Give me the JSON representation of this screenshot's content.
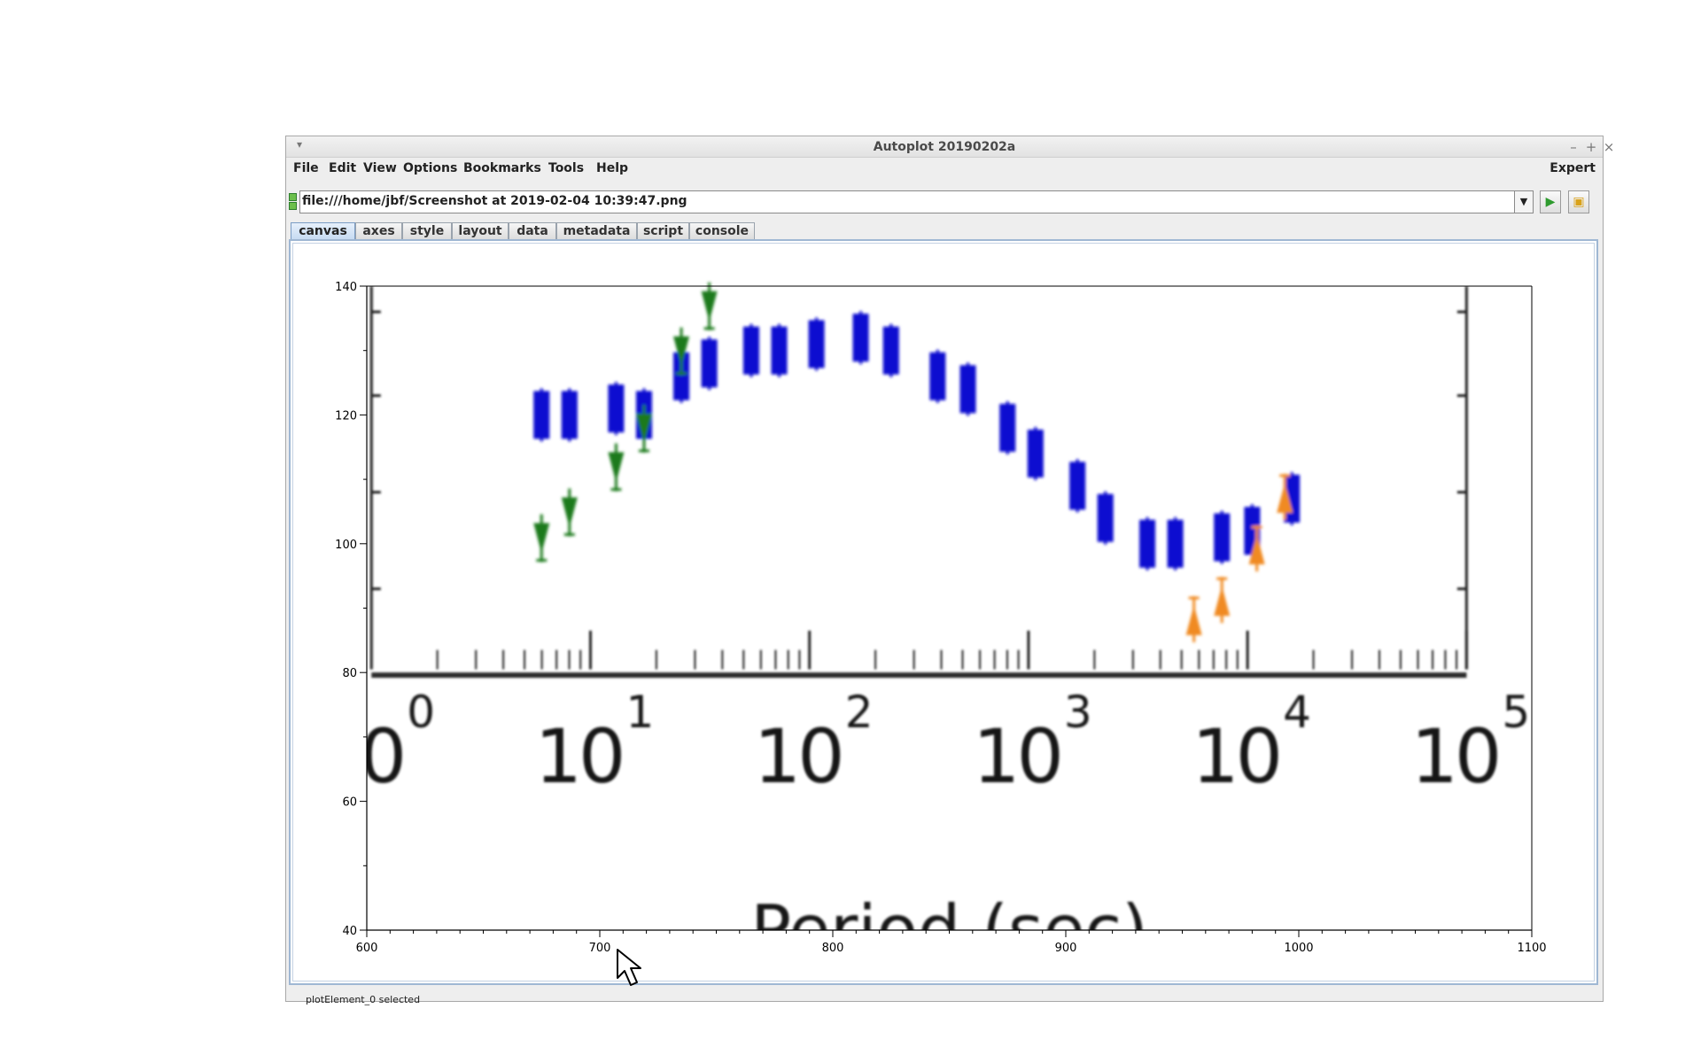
{
  "window": {
    "title": "Autoplot 20190202a"
  },
  "menubar": {
    "items": [
      "File",
      "Edit",
      "View",
      "Options",
      "Bookmarks",
      "Tools",
      "Help"
    ],
    "expert_label": "Expert"
  },
  "address": {
    "value": "file:///home/jbf/Screenshot at 2019-02-04 10:39:47.png"
  },
  "tabs": [
    "canvas",
    "axes",
    "style",
    "layout",
    "data",
    "metadata",
    "script",
    "console"
  ],
  "active_tab": "canvas",
  "status": {
    "text": "plotElement_0 selected"
  },
  "chart_data": {
    "type": "image",
    "x_ticks": [
      600,
      700,
      800,
      900,
      1000,
      1100
    ],
    "xlim": [
      600,
      1100
    ],
    "y_ticks": [
      40,
      60,
      80,
      100,
      120,
      140
    ],
    "ylim": [
      40,
      140
    ],
    "image_content": {
      "inner_x_tick_labels": [
        "0",
        "10",
        "10",
        "10",
        "10",
        "10"
      ],
      "inner_x_tick_exponents": [
        "0",
        "1",
        "2",
        "3",
        "4",
        "5"
      ],
      "inner_xlabel": "Period (sec)",
      "series": [
        {
          "color": "#0a0ad0",
          "marker": "square",
          "x": [
            675,
            687,
            707,
            719,
            735,
            747,
            765,
            777,
            793,
            812,
            825,
            845,
            858,
            875,
            887,
            905,
            917,
            935,
            947,
            967,
            980,
            997
          ],
          "y": [
            120,
            120,
            121,
            120,
            126,
            128,
            130,
            130,
            131,
            132,
            130,
            126,
            124,
            118,
            114,
            109,
            104,
            100,
            100,
            101,
            102,
            107
          ]
        },
        {
          "color": "#1a7a1a",
          "marker": "triangle-down",
          "x": [
            675,
            687,
            707,
            719,
            735,
            747
          ],
          "y": [
            101,
            105,
            112,
            118,
            130,
            137
          ]
        },
        {
          "color": "#f08a24",
          "marker": "triangle-up",
          "x": [
            955,
            967,
            982,
            994
          ],
          "y": [
            88,
            91,
            99,
            107
          ]
        }
      ]
    }
  },
  "colors": {
    "panel_border": "#9fb7d3",
    "active_tab": "#c7dbf2"
  }
}
